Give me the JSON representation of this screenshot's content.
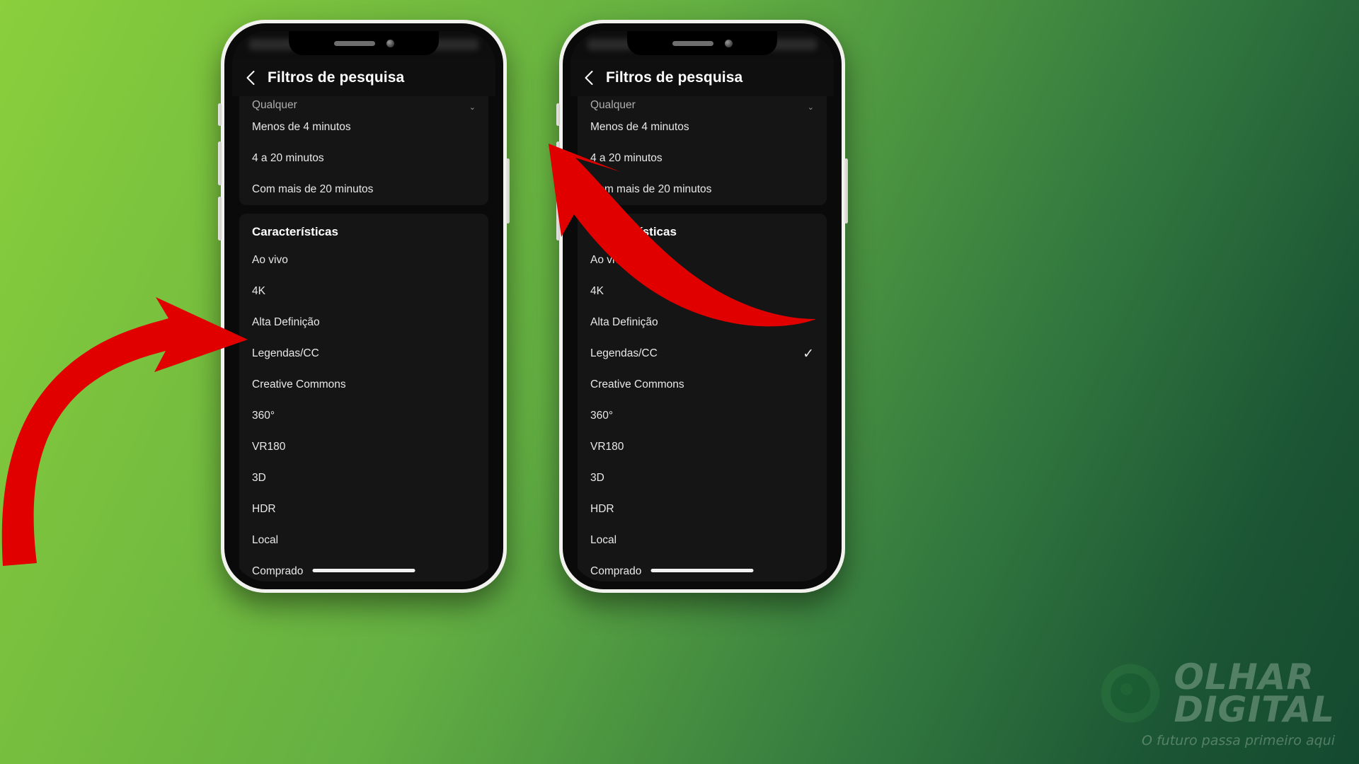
{
  "background": {
    "gradient_from": "#8ACF3C",
    "gradient_to": "#14492F"
  },
  "annotation": {
    "arrow_color": "#E00000",
    "left_arrow_target": "Legendas/CC",
    "right_arrow_target": "back-button"
  },
  "phones": [
    {
      "id": "left",
      "appbar": {
        "back_icon": "chevron-left-icon",
        "title": "Filtros de pesquisa"
      },
      "top_card": {
        "cut_row": "Qualquer",
        "rows": [
          "Menos de 4 minutos",
          "4 a 20 minutos",
          "Com mais de 20 minutos"
        ]
      },
      "section": {
        "title": "Características",
        "items": [
          {
            "label": "Ao vivo",
            "checked": false
          },
          {
            "label": "4K",
            "checked": false
          },
          {
            "label": "Alta Definição",
            "checked": false
          },
          {
            "label": "Legendas/CC",
            "checked": false
          },
          {
            "label": "Creative Commons",
            "checked": false
          },
          {
            "label": "360°",
            "checked": false
          },
          {
            "label": "VR180",
            "checked": false
          },
          {
            "label": "3D",
            "checked": false
          },
          {
            "label": "HDR",
            "checked": false
          },
          {
            "label": "Local",
            "checked": false
          },
          {
            "label": "Comprado",
            "checked": false
          }
        ]
      }
    },
    {
      "id": "right",
      "appbar": {
        "back_icon": "chevron-left-icon",
        "title": "Filtros de pesquisa"
      },
      "top_card": {
        "cut_row": "Qualquer",
        "rows": [
          "Menos de 4 minutos",
          "4 a 20 minutos",
          "Com mais de 20 minutos"
        ]
      },
      "section": {
        "title": "Características",
        "items": [
          {
            "label": "Ao vivo",
            "checked": false
          },
          {
            "label": "4K",
            "checked": false
          },
          {
            "label": "Alta Definição",
            "checked": false
          },
          {
            "label": "Legendas/CC",
            "checked": true
          },
          {
            "label": "Creative Commons",
            "checked": false
          },
          {
            "label": "360°",
            "checked": false
          },
          {
            "label": "VR180",
            "checked": false
          },
          {
            "label": "3D",
            "checked": false
          },
          {
            "label": "HDR",
            "checked": false
          },
          {
            "label": "Local",
            "checked": false
          },
          {
            "label": "Comprado",
            "checked": false
          }
        ]
      }
    }
  ],
  "watermark": {
    "line1": "OLHAR",
    "line2": "DIGITAL",
    "tagline": "O futuro passa primeiro aqui",
    "icon": "eye-logo-icon"
  },
  "checkmark_glyph": "✓",
  "chevron_down_glyph": "⌄"
}
